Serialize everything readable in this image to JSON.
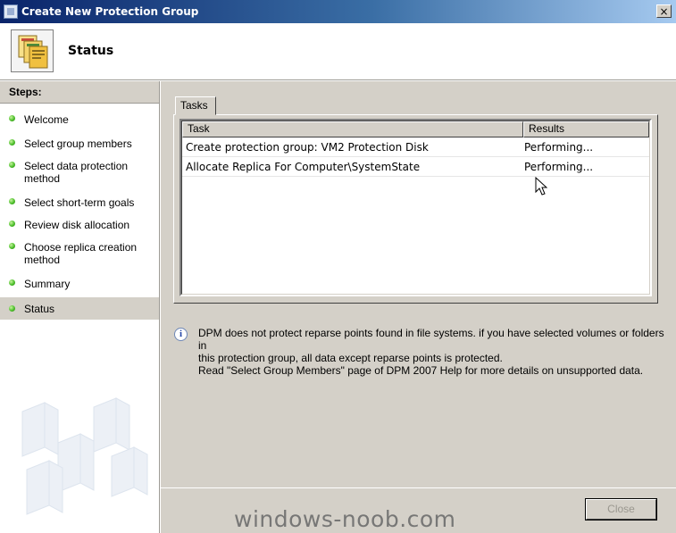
{
  "window": {
    "title": "Create New Protection Group",
    "close_glyph": "×"
  },
  "header": {
    "title": "Status",
    "icon": "protection-group-icon"
  },
  "sidebar": {
    "heading": "Steps:",
    "items": [
      {
        "label": "Welcome",
        "status_color": "#4cbf2b"
      },
      {
        "label": "Select group members",
        "status_color": "#4cbf2b"
      },
      {
        "label": "Select data protection method",
        "status_color": "#4cbf2b"
      },
      {
        "label": "Select short-term goals",
        "status_color": "#4cbf2b"
      },
      {
        "label": "Review disk allocation",
        "status_color": "#4cbf2b"
      },
      {
        "label": "Choose replica creation method",
        "status_color": "#4cbf2b"
      },
      {
        "label": "Summary",
        "status_color": "#4cbf2b"
      },
      {
        "label": "Status",
        "status_color": "#4cbf2b"
      }
    ],
    "active_index": 7
  },
  "tabs": [
    {
      "label": "Tasks"
    }
  ],
  "tasks_table": {
    "columns": [
      "Task",
      "Results"
    ],
    "rows": [
      {
        "task": "Create protection group: VM2 Protection Disk",
        "result": "Performing..."
      },
      {
        "task": "Allocate Replica For Computer\\SystemState",
        "result": "Performing..."
      }
    ]
  },
  "info": {
    "icon": "info-icon",
    "line1": "DPM does not protect reparse points found in file systems. if you have selected volumes or folders in",
    "line2": "this protection group, all data except reparse points is protected.",
    "line3": "Read \"Select Group Members\" page of DPM 2007 Help for more details on unsupported data."
  },
  "footer": {
    "close_label": "Close",
    "close_enabled": false,
    "watermark": "windows-noob.com"
  },
  "colors": {
    "title_bar": "#0a246a",
    "dialog_face": "#d4d0c8",
    "step_done": "#4cbf2b"
  }
}
